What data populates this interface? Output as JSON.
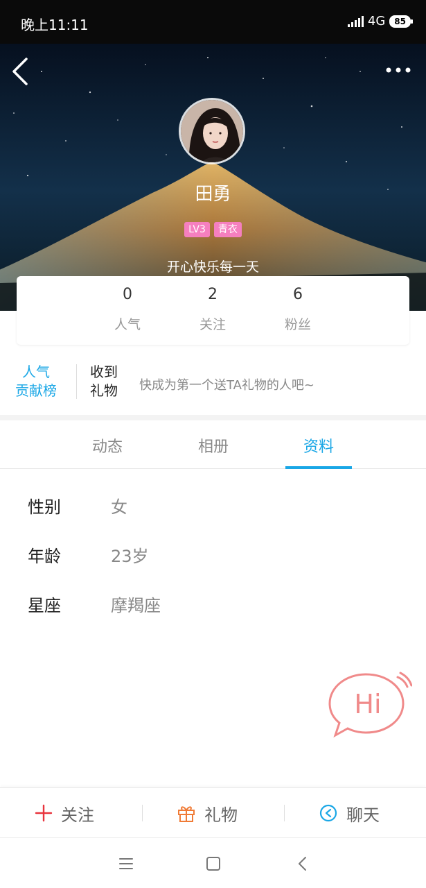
{
  "status_bar": {
    "time": "晚上11:11",
    "network": "4G",
    "battery": "85"
  },
  "header": {
    "back_icon": "chevron-left-icon",
    "more_icon": "more-dots-icon",
    "nickname": "田勇",
    "badges": [
      "LV3",
      "青衣"
    ],
    "signature": "开心快乐每一天"
  },
  "stats": [
    {
      "value": "0",
      "label": "人气"
    },
    {
      "value": "2",
      "label": "关注"
    },
    {
      "value": "6",
      "label": "粉丝"
    }
  ],
  "contribution": {
    "rank_line1": "人气",
    "rank_line2": "贡献榜",
    "gift_line1": "收到",
    "gift_line2": "礼物",
    "hint": "快成为第一个送TA礼物的人吧~"
  },
  "tabs": [
    {
      "label": "动态"
    },
    {
      "label": "相册"
    },
    {
      "label": "资料",
      "active": true
    }
  ],
  "profile": [
    {
      "label": "性别",
      "value": "女"
    },
    {
      "label": "年龄",
      "value": "23岁"
    },
    {
      "label": "星座",
      "value": "摩羯座"
    }
  ],
  "hi_bubble": {
    "text": "Hi"
  },
  "actions": [
    {
      "label": "关注",
      "icon": "plus-icon",
      "color": "#e8343d"
    },
    {
      "label": "礼物",
      "icon": "gift-icon",
      "color": "#f07b36"
    },
    {
      "label": "聊天",
      "icon": "chat-icon",
      "color": "#1aa7e6"
    }
  ],
  "colors": {
    "accent": "#1aa7e6",
    "badge": "#f57fbf",
    "hi": "#f08a8a"
  }
}
